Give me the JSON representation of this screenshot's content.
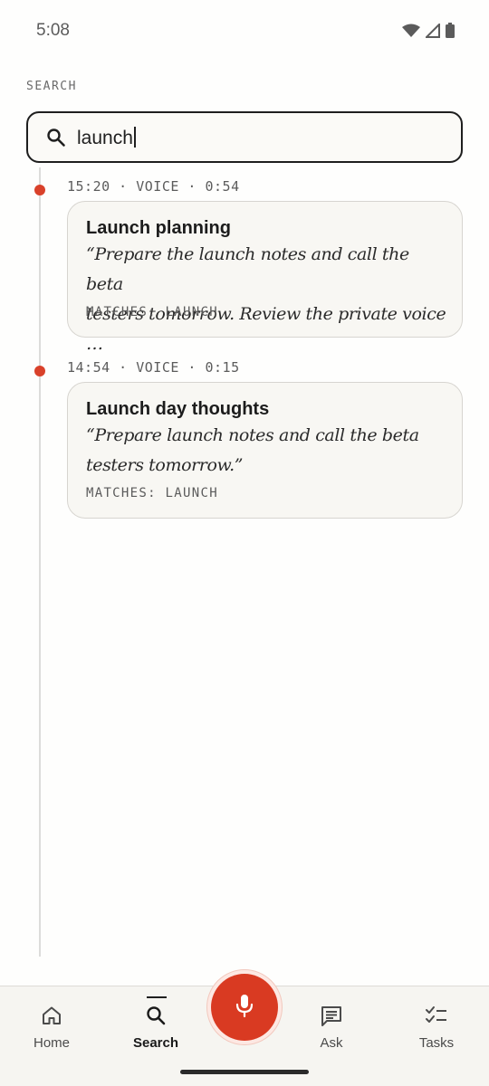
{
  "status_bar": {
    "time": "5:08",
    "icons": [
      "wifi-icon",
      "signal-icon",
      "battery-icon"
    ]
  },
  "page": {
    "section_label": "SEARCH"
  },
  "search": {
    "value": "launch",
    "icon": "search-icon"
  },
  "results": [
    {
      "meta": "15:20 · VOICE · 0:54",
      "title": "Launch planning",
      "quote_line1": "“Prepare the launch notes and call the beta",
      "quote_line2": "testers tomorrow. Review the private voice …",
      "matches": "MATCHES: LAUNCH"
    },
    {
      "meta": "14:54 · VOICE · 0:15",
      "title": "Launch day thoughts",
      "quote_line1": "“Prepare launch notes and call the beta",
      "quote_line2": "testers tomorrow.”",
      "matches": "MATCHES: LAUNCH"
    }
  ],
  "bottom_nav": {
    "items": [
      {
        "label": "Home",
        "icon": "home-icon"
      },
      {
        "label": "Search",
        "icon": "search-icon",
        "active": true
      },
      {
        "label": "Ask",
        "icon": "chat-icon"
      },
      {
        "label": "Tasks",
        "icon": "tasks-icon"
      }
    ],
    "record_icon": "microphone-icon"
  },
  "colors": {
    "accent": "#d93a22",
    "timeline_dot": "#d9412a",
    "card_background": "#f8f7f3",
    "nav_background": "#f6f5f1"
  }
}
